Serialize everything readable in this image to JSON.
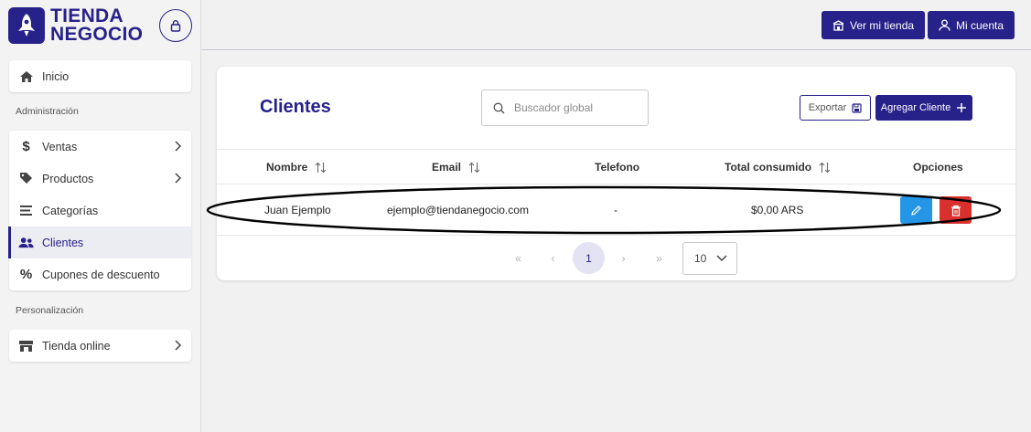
{
  "brand": {
    "line1": "TIENDA",
    "line2": "NEGOCIO"
  },
  "sidebar": {
    "home": "Inicio",
    "section_admin": "Administración",
    "admin_items": [
      {
        "label": "Ventas",
        "icon": "dollar-icon",
        "chevron": true
      },
      {
        "label": "Productos",
        "icon": "tag-icon",
        "chevron": true
      },
      {
        "label": "Categorías",
        "icon": "list-icon",
        "chevron": false
      },
      {
        "label": "Clientes",
        "icon": "users-icon",
        "chevron": false,
        "active": true
      },
      {
        "label": "Cupones de descuento",
        "icon": "percent-icon",
        "chevron": false
      }
    ],
    "section_custom": "Personalización",
    "custom_items": [
      {
        "label": "Tienda online",
        "icon": "store-icon",
        "chevron": true
      }
    ]
  },
  "header": {
    "view_store": "Ver mi tienda",
    "my_account": "Mi cuenta"
  },
  "main": {
    "title": "Clientes",
    "search_placeholder": "Buscador global",
    "export_label": "Exportar",
    "add_label": "Agregar Cliente"
  },
  "table": {
    "columns": [
      "Nombre",
      "Email",
      "Telefono",
      "Total consumido",
      "Opciones"
    ],
    "rows": [
      {
        "name": "Juan Ejemplo",
        "email": "ejemplo@tiendanegocio.com",
        "phone": "-",
        "total": "$0,00 ARS"
      }
    ]
  },
  "pagination": {
    "first": "«",
    "prev": "‹",
    "current": "1",
    "next": "›",
    "last": "»",
    "rows_per_page": "10"
  },
  "colors": {
    "brand": "#27218a",
    "edit": "#2596e6",
    "delete": "#d9302e"
  }
}
